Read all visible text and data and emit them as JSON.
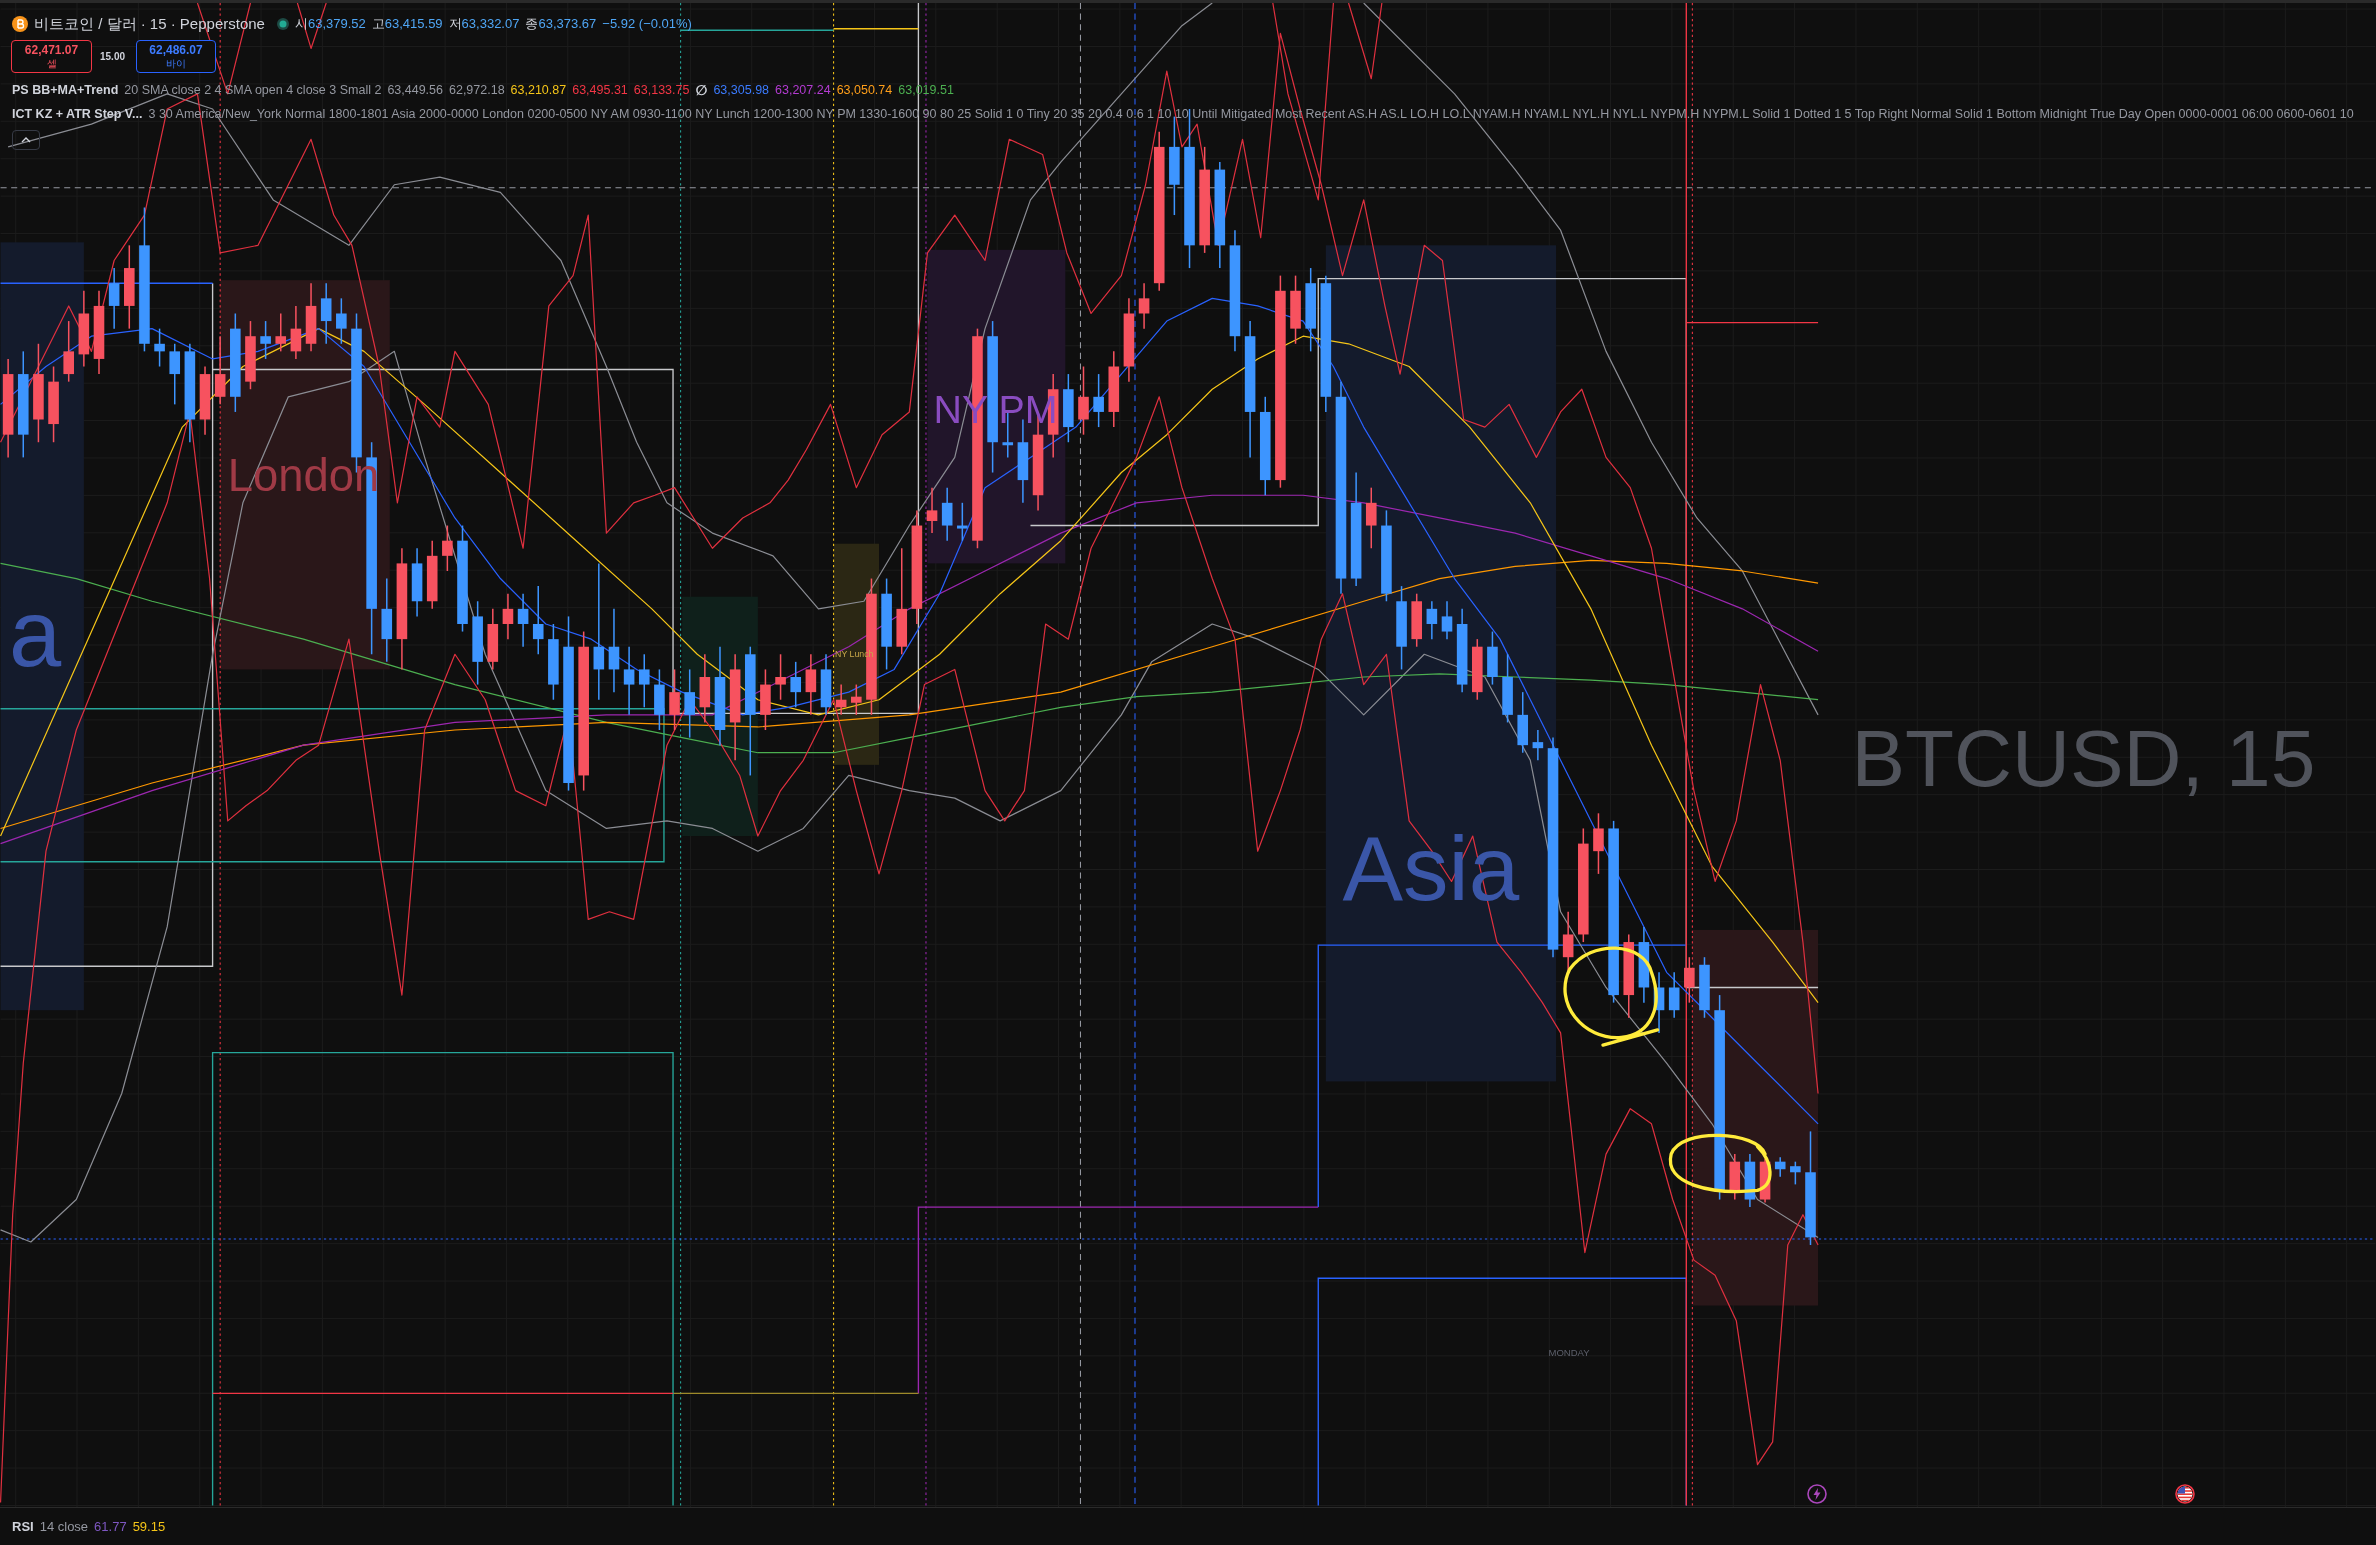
{
  "symbol_bar": {
    "title": "비트코인 / 달러 · 15 · Pepperstone",
    "market_open": true,
    "ohlc": [
      {
        "label": "시",
        "value": "63,379.52"
      },
      {
        "label": "고",
        "value": "63,415.59"
      },
      {
        "label": "저",
        "value": "63,332.07"
      },
      {
        "label": "종",
        "value": "63,373.67"
      }
    ],
    "change": "−5.92 (−0.01%)"
  },
  "order_panel": {
    "sell": {
      "price": "62,471.07",
      "label": "셀"
    },
    "spread": "15.00",
    "buy": {
      "price": "62,486.07",
      "label": "바이"
    }
  },
  "indicators": [
    {
      "name": "PS BB+MA+Trend",
      "params": "20 SMA close 2 4 SMA open 4 close 3 Small 2",
      "values": [
        {
          "kind": "value",
          "text": "63,449.56",
          "color": "#9598a1"
        },
        {
          "kind": "value",
          "text": "62,972.18",
          "color": "#9598a1"
        },
        {
          "kind": "value",
          "text": "63,210.87",
          "color": "#f5c518"
        },
        {
          "kind": "value",
          "text": "63,495.31",
          "color": "#f23645"
        },
        {
          "kind": "value",
          "text": "63,133.75",
          "color": "#f23645"
        },
        {
          "kind": "glyph",
          "text": "∅",
          "color": "#d1d4dc"
        },
        {
          "kind": "value",
          "text": "63,305.98",
          "color": "#3b7bff"
        },
        {
          "kind": "value",
          "text": "63,207.24",
          "color": "#b33bd1"
        },
        {
          "kind": "value",
          "text": "63,050.74",
          "color": "#ff9f1a"
        },
        {
          "kind": "value",
          "text": "63,019.51",
          "color": "#4caf50"
        }
      ]
    },
    {
      "name": "ICT KZ + ATR Step V...",
      "params": "3 30 America/New_York Normal 1800-1801 Asia 2000-0000 London 0200-0500 NY AM 0930-1100 NY Lunch 1200-1300 NY PM 1330-1600 90 80 25 Solid 1 0 Tiny 20 35 20 0.4 0.6 1 10 10 Until Mitigated Most Recent AS.H AS.L LO.H LO.L NYAM.H NYAM.L NYL.H NYL.L NYPM.H NYPM.L Solid 1 Dotted 1 5 Top Right Normal Solid 1 Bottom Midnight True Day Open 0000-0001 06:00 0600-0601 10"
    }
  ],
  "chart": {
    "session_labels": [
      {
        "kind": "asia",
        "label": "a"
      },
      {
        "kind": "london",
        "label": "London"
      },
      {
        "kind": "ny_lunch",
        "label": "NY Lunch"
      },
      {
        "kind": "ny_pm",
        "label": "NY PM"
      },
      {
        "kind": "asia",
        "label": "Asia"
      }
    ],
    "symbol_watermark": "BTCUSD, 15",
    "day_label": "MONDAY"
  },
  "rsi": {
    "name": "RSI",
    "params": "14 close",
    "values": [
      {
        "text": "61.77",
        "color": "#7e57c2"
      },
      {
        "text": "59.15",
        "color": "#f5c518"
      }
    ]
  }
}
